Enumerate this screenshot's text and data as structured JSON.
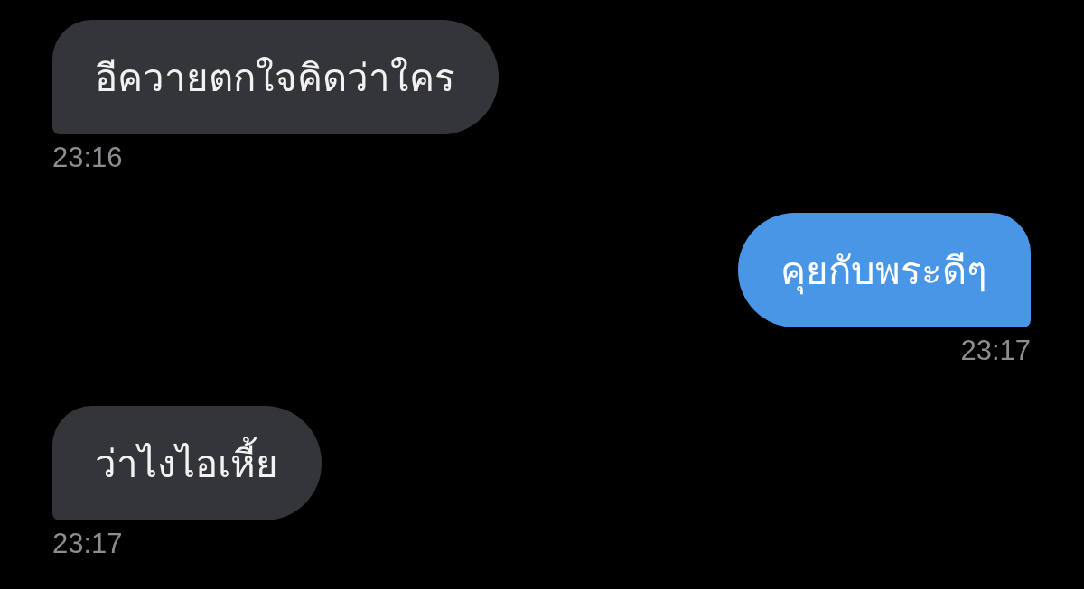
{
  "messages": [
    {
      "kind": "received",
      "text": "อีควายตกใจคิดว่าใคร",
      "time": "23:16"
    },
    {
      "kind": "sent",
      "text": "คุยกับพระดีๆ",
      "time": "23:17"
    },
    {
      "kind": "received",
      "text": "ว่าไงไอเหี้ย",
      "time": "23:17"
    }
  ]
}
